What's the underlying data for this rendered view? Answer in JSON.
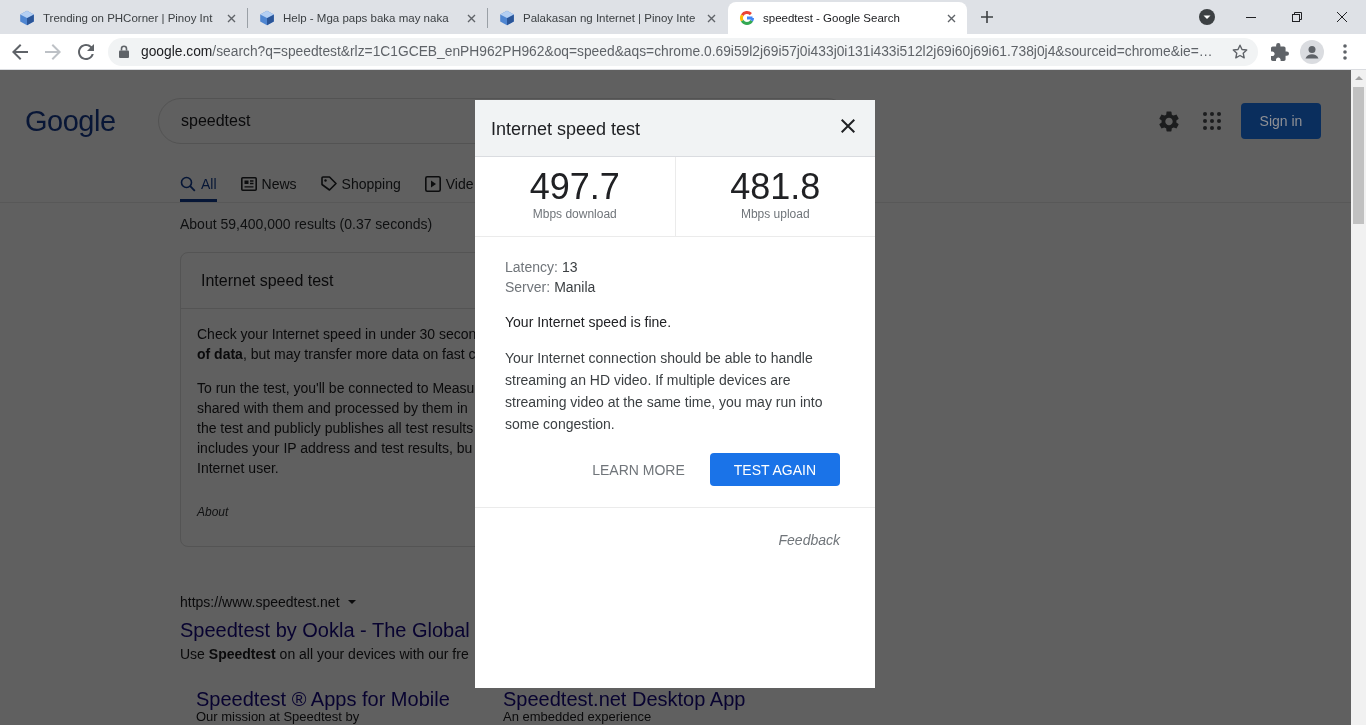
{
  "browser": {
    "tabs": [
      {
        "title": "Trending on PHCorner | Pinoy Int",
        "selected": false
      },
      {
        "title": "Help - Mga paps baka may naka",
        "selected": false
      },
      {
        "title": "Palakasan ng Internet | Pinoy Inte",
        "selected": false
      },
      {
        "title": "speedtest - Google Search",
        "selected": true
      }
    ],
    "forward_disabled": true,
    "address": {
      "host": "google.com",
      "path": "/search?q=speedtest&rlz=1C1GCEB_enPH962PH962&oq=speed&aqs=chrome.0.69i59l2j69i57j0i433j0i131i433i512l2j69i60j69i61.738j0j4&sourceid=chrome&ie=…"
    }
  },
  "page": {
    "logo": "Google",
    "search": {
      "value": "speedtest"
    },
    "sign_in": "Sign in",
    "nav_tabs": [
      {
        "label": "All",
        "selected": true
      },
      {
        "label": "News",
        "selected": false
      },
      {
        "label": "Shopping",
        "selected": false
      },
      {
        "label": "Vide",
        "selected": false
      }
    ],
    "result_stats": "About 59,400,000 results (0.37 seconds)",
    "answer_card": {
      "title": "Internet speed test",
      "paragraphs": [
        [
          "Check your Internet speed in under 30 secon",
          "**of data**, but may transfer more data on fast c"
        ],
        [
          "To run the test, you'll be connected to Measu",
          "shared with them and processed by them in",
          "the test and publicly publishes all test results",
          "includes your IP address and test results, bu",
          "Internet user."
        ]
      ],
      "about": "About"
    },
    "result": {
      "url": "https://www.speedtest.net",
      "title": "Speedtest by Ookla - The Global",
      "snippet": "Use **Speedtest** on all your devices with our fre",
      "sitelinks": [
        {
          "title": "Speedtest ® Apps for Mobile",
          "snippet": "Our mission at Speedtest by"
        },
        {
          "title": "Speedtest.net Desktop App",
          "snippet": "An embedded experience"
        }
      ]
    }
  },
  "dialog": {
    "title": "Internet speed test",
    "metrics": [
      {
        "value": "497.7",
        "unit": "Mbps download"
      },
      {
        "value": "481.8",
        "unit": "Mbps upload"
      }
    ],
    "details": [
      {
        "label": "Latency:",
        "value": "13"
      },
      {
        "label": "Server:",
        "value": "Manila"
      }
    ],
    "status": "Your Internet speed is fine.",
    "description": "Your Internet connection should be able to handle streaming an HD video. If multiple devices are streaming video at the same time, you may run into some congestion.",
    "buttons": [
      {
        "label": "LEARN MORE",
        "kind": "text"
      },
      {
        "label": "TEST AGAIN",
        "kind": "primary"
      }
    ],
    "feedback": "Feedback"
  }
}
